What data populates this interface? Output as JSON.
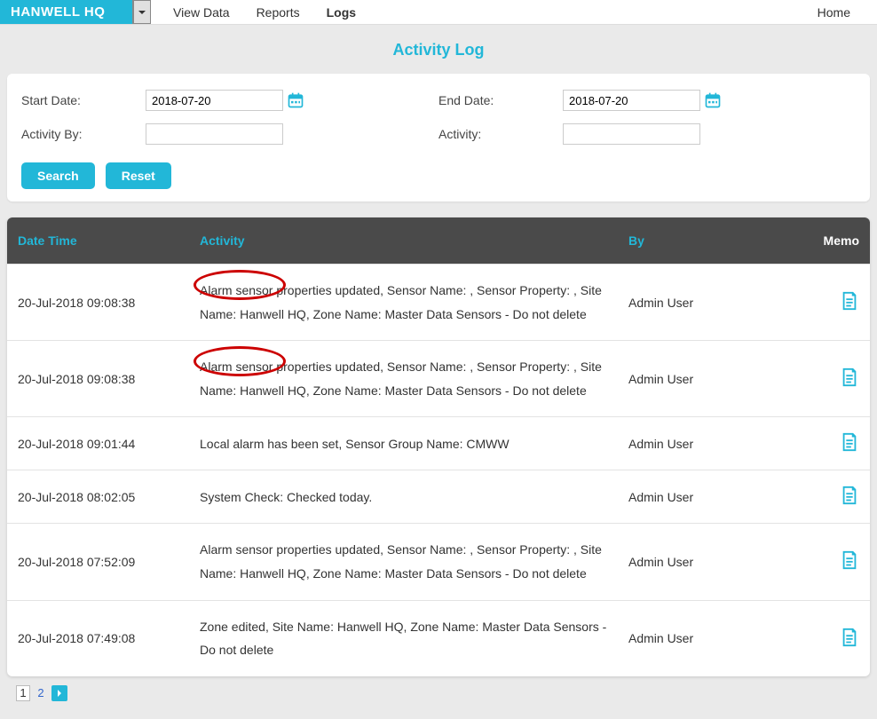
{
  "site": "HANWELL HQ",
  "nav": {
    "view_data": "View Data",
    "reports": "Reports",
    "logs": "Logs",
    "home": "Home"
  },
  "title": "Activity Log",
  "filter": {
    "start_label": "Start Date:",
    "start_value": "2018-07-20",
    "end_label": "End Date:",
    "end_value": "2018-07-20",
    "activity_by_label": "Activity By:",
    "activity_by_value": "",
    "activity_label": "Activity:",
    "activity_value": "",
    "search_btn": "Search",
    "reset_btn": "Reset"
  },
  "columns": {
    "dt": "Date Time",
    "act": "Activity",
    "by": "By",
    "memo": "Memo"
  },
  "rows": [
    {
      "dt": "20-Jul-2018 09:08:38",
      "act": "Alarm sensor properties updated, Sensor Name: , Sensor Property: , Site Name: Hanwell HQ, Zone Name: Master Data Sensors - Do not delete",
      "by": "Admin User",
      "annot": true
    },
    {
      "dt": "20-Jul-2018 09:08:38",
      "act": "Alarm sensor properties updated, Sensor Name: , Sensor Property: , Site Name: Hanwell HQ, Zone Name: Master Data Sensors - Do not delete",
      "by": "Admin User",
      "annot": true
    },
    {
      "dt": "20-Jul-2018 09:01:44",
      "act": "Local alarm has been set, Sensor Group Name: CMWW",
      "by": "Admin User",
      "annot": false
    },
    {
      "dt": "20-Jul-2018 08:02:05",
      "act": "System Check: Checked today.",
      "by": "Admin User",
      "annot": false
    },
    {
      "dt": "20-Jul-2018 07:52:09",
      "act": "Alarm sensor properties updated, Sensor Name: , Sensor Property: , Site Name: Hanwell HQ, Zone Name: Master Data Sensors - Do not delete",
      "by": "Admin User",
      "annot": false
    },
    {
      "dt": "20-Jul-2018 07:49:08",
      "act": "Zone edited, Site Name: Hanwell HQ, Zone Name: Master Data Sensors - Do not delete",
      "by": "Admin User",
      "annot": false
    }
  ],
  "pager": {
    "p1": "1",
    "p2": "2"
  }
}
